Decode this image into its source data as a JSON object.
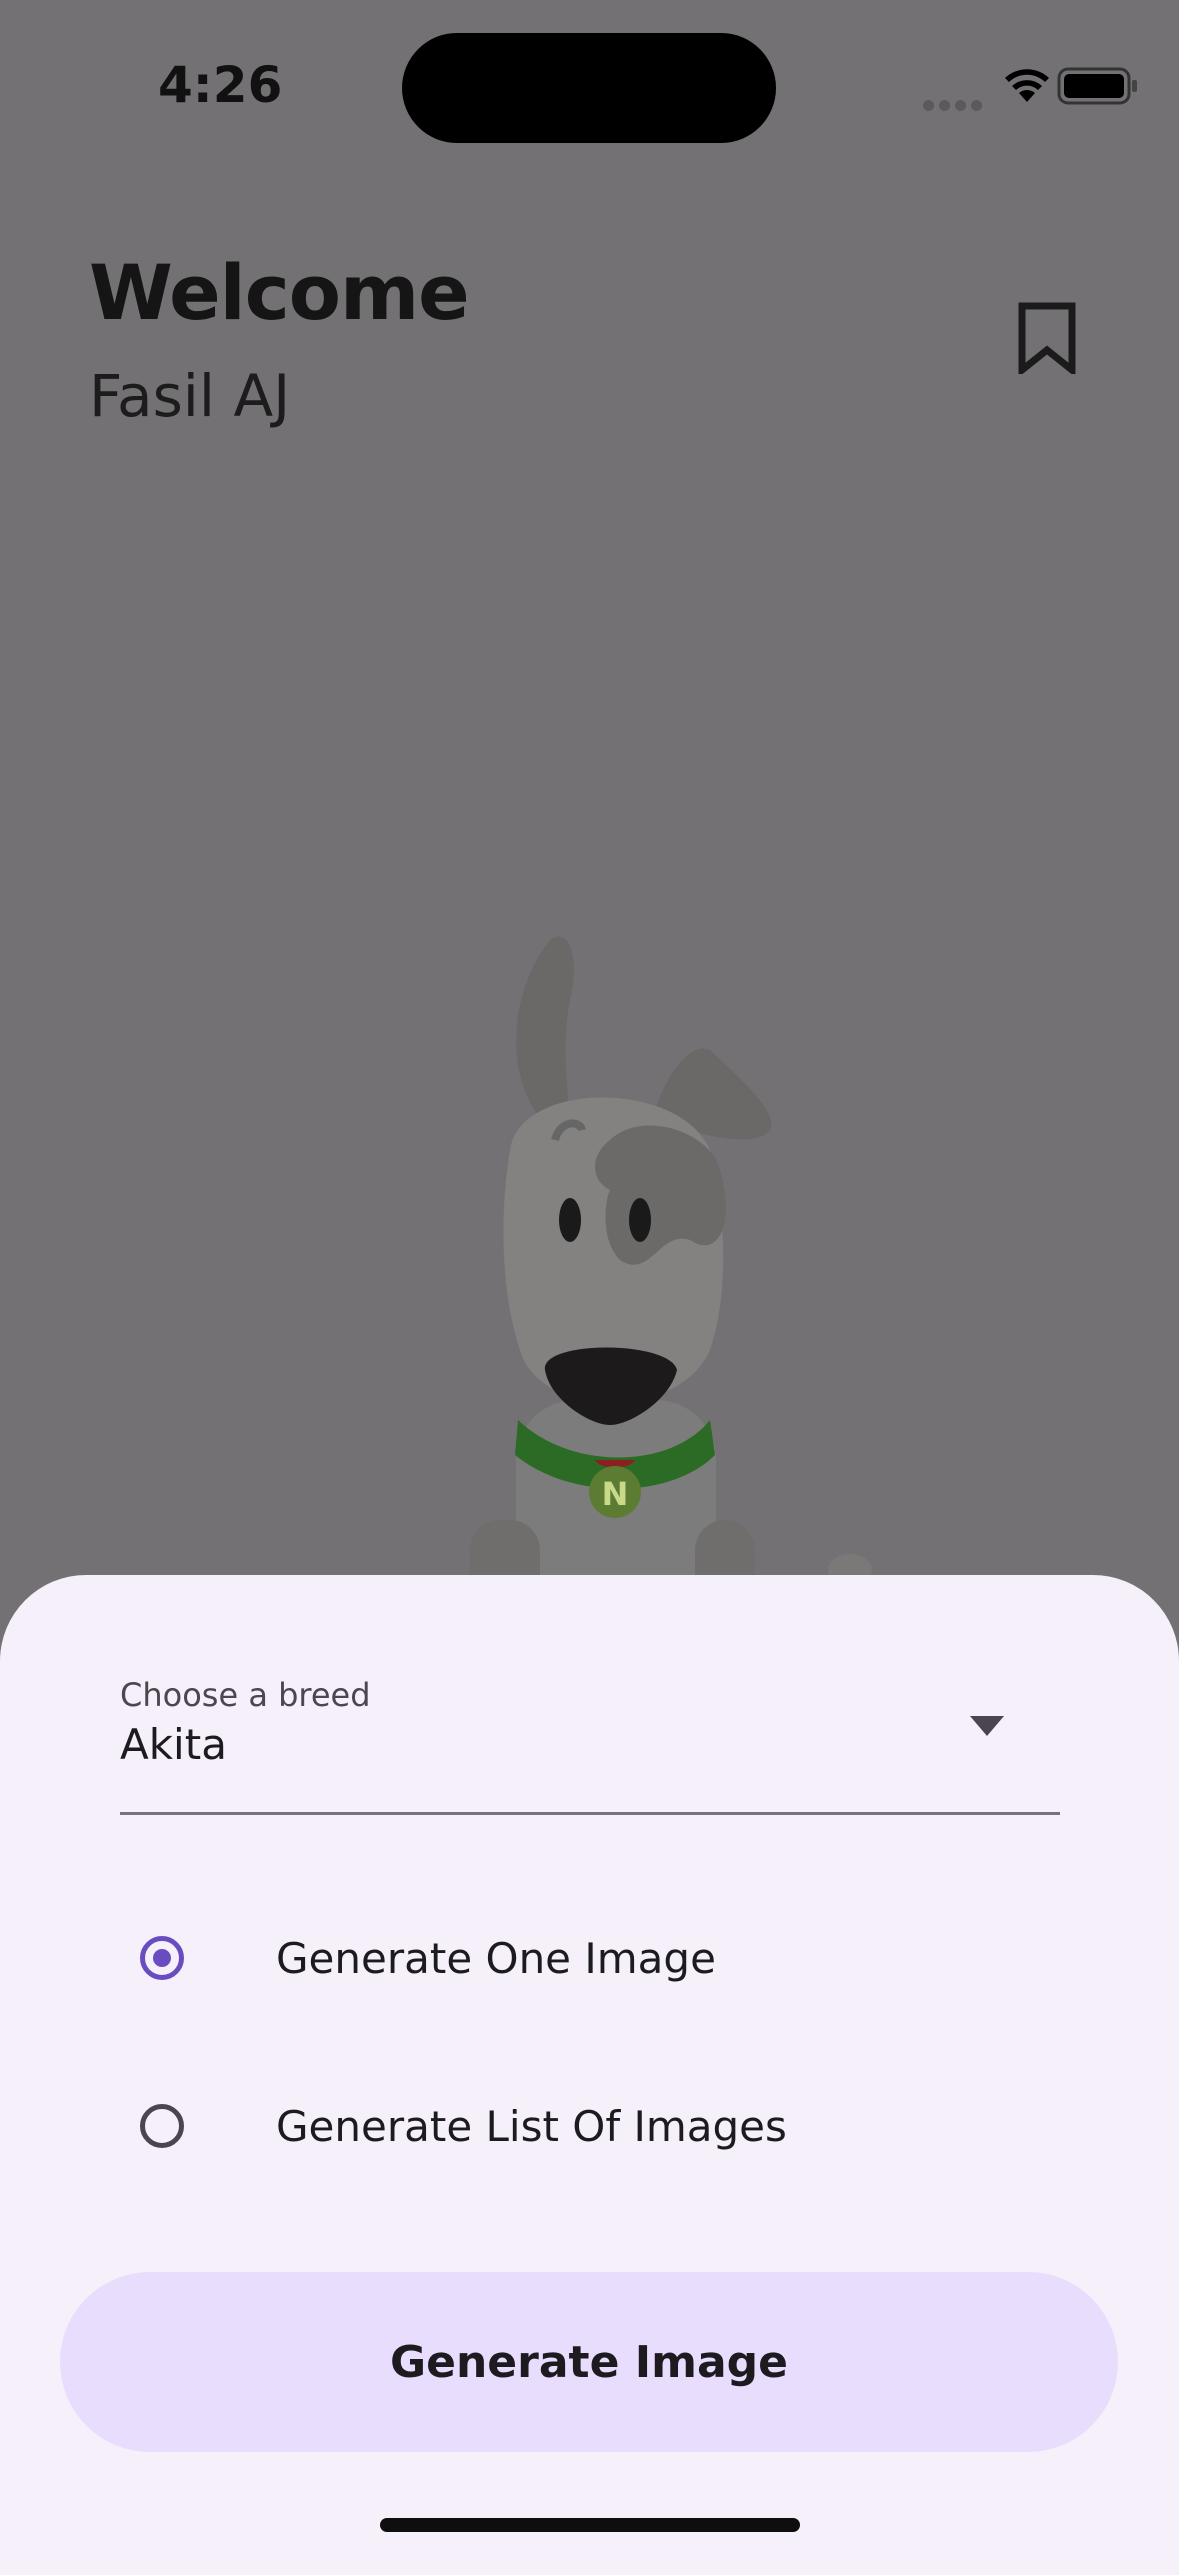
{
  "status_bar": {
    "time": "4:26",
    "icons": [
      "signal-icon",
      "wifi-icon",
      "battery-icon"
    ]
  },
  "header": {
    "title": "Welcome",
    "subtitle": "Fasil AJ",
    "bookmark_icon": "bookmark-icon"
  },
  "illustration": {
    "name": "dog-mascot",
    "badge": "N"
  },
  "sheet": {
    "dropdown": {
      "label": "Choose a breed",
      "value": "Akita"
    },
    "radio_options": [
      {
        "label": "Generate One Image",
        "selected": true
      },
      {
        "label": "Generate List Of Images",
        "selected": false
      }
    ],
    "button_label": "Generate Image"
  },
  "colors": {
    "accent": "#6a4cc1",
    "button_bg": "#e9ddfe",
    "sheet_bg": "#f5f0f9",
    "scrim": "#737174"
  }
}
